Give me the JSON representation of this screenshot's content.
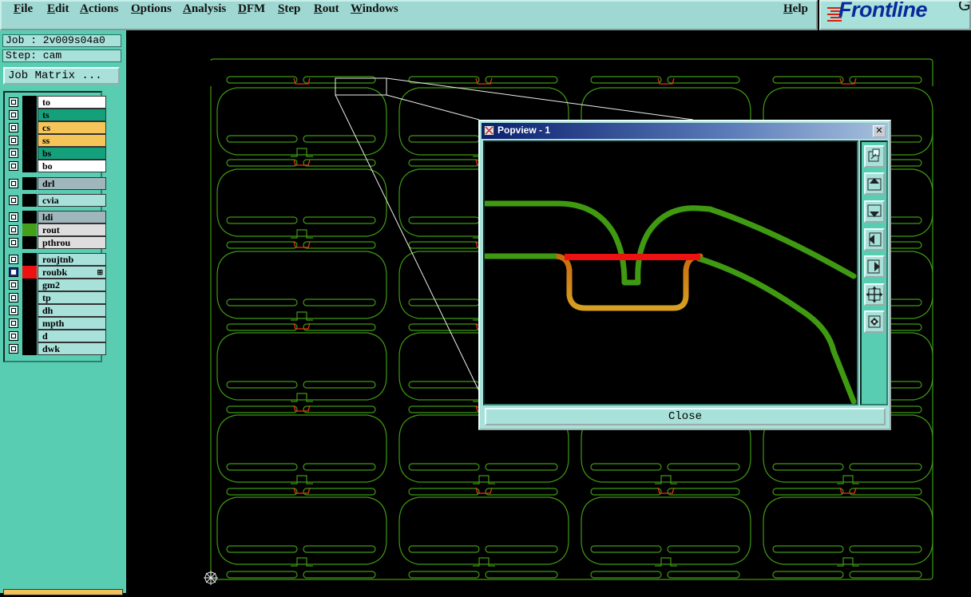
{
  "menu": {
    "items": [
      {
        "key": "file",
        "label": "File"
      },
      {
        "key": "edit",
        "label": "Edit"
      },
      {
        "key": "actions",
        "label": "Actions"
      },
      {
        "key": "options",
        "label": "Options"
      },
      {
        "key": "analysis",
        "label": "Analysis"
      },
      {
        "key": "dfm",
        "label": "DFM"
      },
      {
        "key": "step",
        "label": "Step"
      },
      {
        "key": "rout",
        "label": "Rout"
      },
      {
        "key": "windows",
        "label": "Windows"
      },
      {
        "key": "help",
        "label": "Help"
      }
    ]
  },
  "brand": {
    "name": "Frontline",
    "suffix": "G",
    "color": "#0a2a9a",
    "accent": "#d82010"
  },
  "job": {
    "job_label": "Job : 2v009s04a0",
    "step_label": "Step: cam",
    "matrix_button": "Job Matrix ..."
  },
  "layers": [
    {
      "name": "to",
      "color": "#ffffff",
      "checked": false
    },
    {
      "name": "ts",
      "color": "#15a07c",
      "checked": false
    },
    {
      "name": "cs",
      "color": "#f6c55a",
      "checked": false
    },
    {
      "name": "ss",
      "color": "#f6c55a",
      "checked": false
    },
    {
      "name": "bs",
      "color": "#15a07c",
      "checked": false
    },
    {
      "name": "bo",
      "color": "#ffffff",
      "checked": false
    },
    {
      "name": "drl",
      "color": "#9fb7bc",
      "checked": false
    },
    {
      "name": "cvia",
      "color": "#a8e0da",
      "checked": false
    },
    {
      "name": "ldi",
      "color": "#9fb7bc",
      "checked": false
    },
    {
      "name": "rout",
      "color": "#dedede",
      "checked": false,
      "swatch": "#44a01a"
    },
    {
      "name": "pthrou",
      "color": "#dedede",
      "checked": false
    },
    {
      "name": "roujtnb",
      "color": "#a8e0da",
      "checked": false
    },
    {
      "name": "roubk",
      "color": "#a8e0da",
      "checked": true,
      "swatch": "#ee1111",
      "indicator": "⊞"
    },
    {
      "name": "gm2",
      "color": "#a8e0da",
      "checked": false
    },
    {
      "name": "tp",
      "color": "#a8e0da",
      "checked": false
    },
    {
      "name": "dh",
      "color": "#a8e0da",
      "checked": false
    },
    {
      "name": "mpth",
      "color": "#a8e0da",
      "checked": false
    },
    {
      "name": "d",
      "color": "#a8e0da",
      "checked": false
    },
    {
      "name": "dwk",
      "color": "#a8e0da",
      "checked": false
    }
  ],
  "colors": {
    "rout": "#3f9a12",
    "tab": "#ee3311",
    "canvas": "#000000",
    "panel": "#58cdb2"
  },
  "popview": {
    "title": "Popview - 1",
    "close_label": "Close",
    "tools": [
      "zoom-fit-icon",
      "pan-up-icon",
      "pan-down-icon",
      "pan-left-icon",
      "pan-right-icon",
      "zoom-in-icon",
      "zoom-out-icon"
    ]
  }
}
